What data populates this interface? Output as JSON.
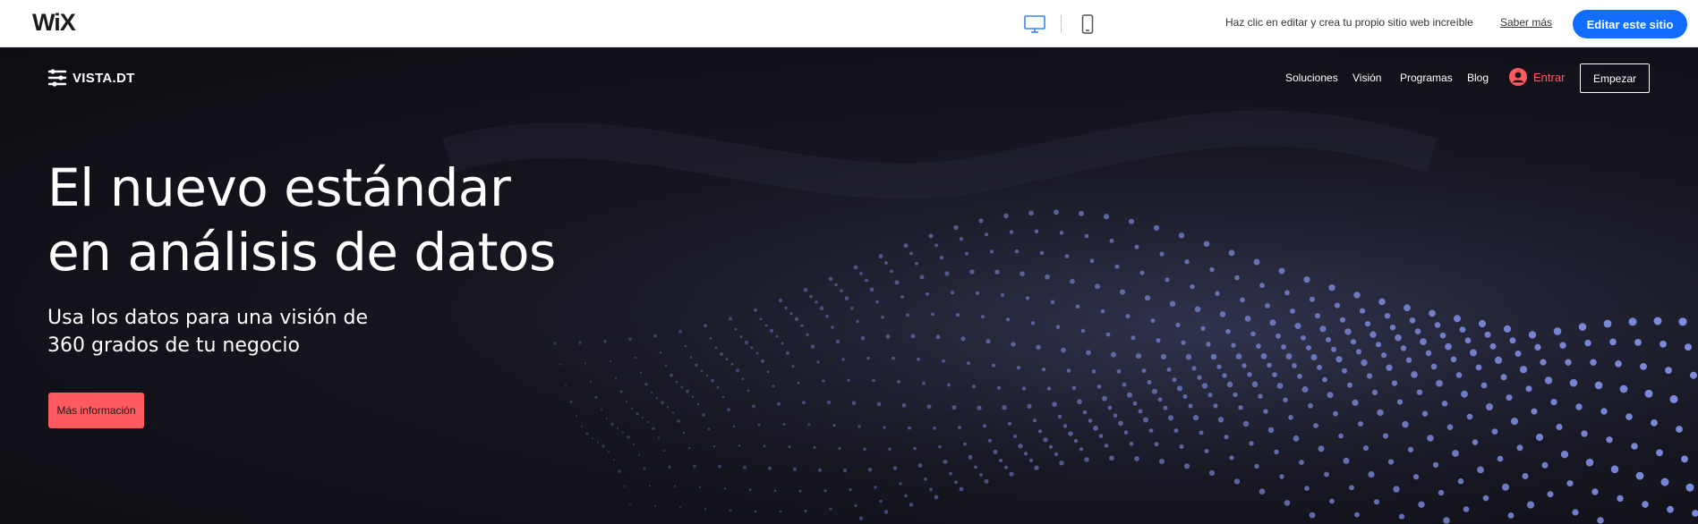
{
  "wix_bar": {
    "logo": "WiX",
    "devices": [
      {
        "icon": "desktop-icon",
        "active": true
      },
      {
        "icon": "mobile-icon",
        "active": false
      }
    ],
    "message": "Haz clic en editar y crea tu propio sitio web increíble",
    "learn_more": "Saber más",
    "edit_button": "Editar este sitio",
    "accent_color": "#116dff"
  },
  "site": {
    "logo_icon": "sliders-icon",
    "logo_text": "VISTA.DT",
    "nav": [
      "Soluciones",
      "Visión",
      "Programas",
      "Blog"
    ],
    "login_icon": "user-avatar-icon",
    "login_label": "Entrar",
    "start_button": "Empezar",
    "accent_color": "#ff5a5f"
  },
  "hero": {
    "headline_line1": "El nuevo estándar",
    "headline_line2": "en análisis de datos",
    "sub_line1": "Usa los datos para una visión de",
    "sub_line2": "360 grados de tu negocio",
    "cta": "Más información"
  }
}
